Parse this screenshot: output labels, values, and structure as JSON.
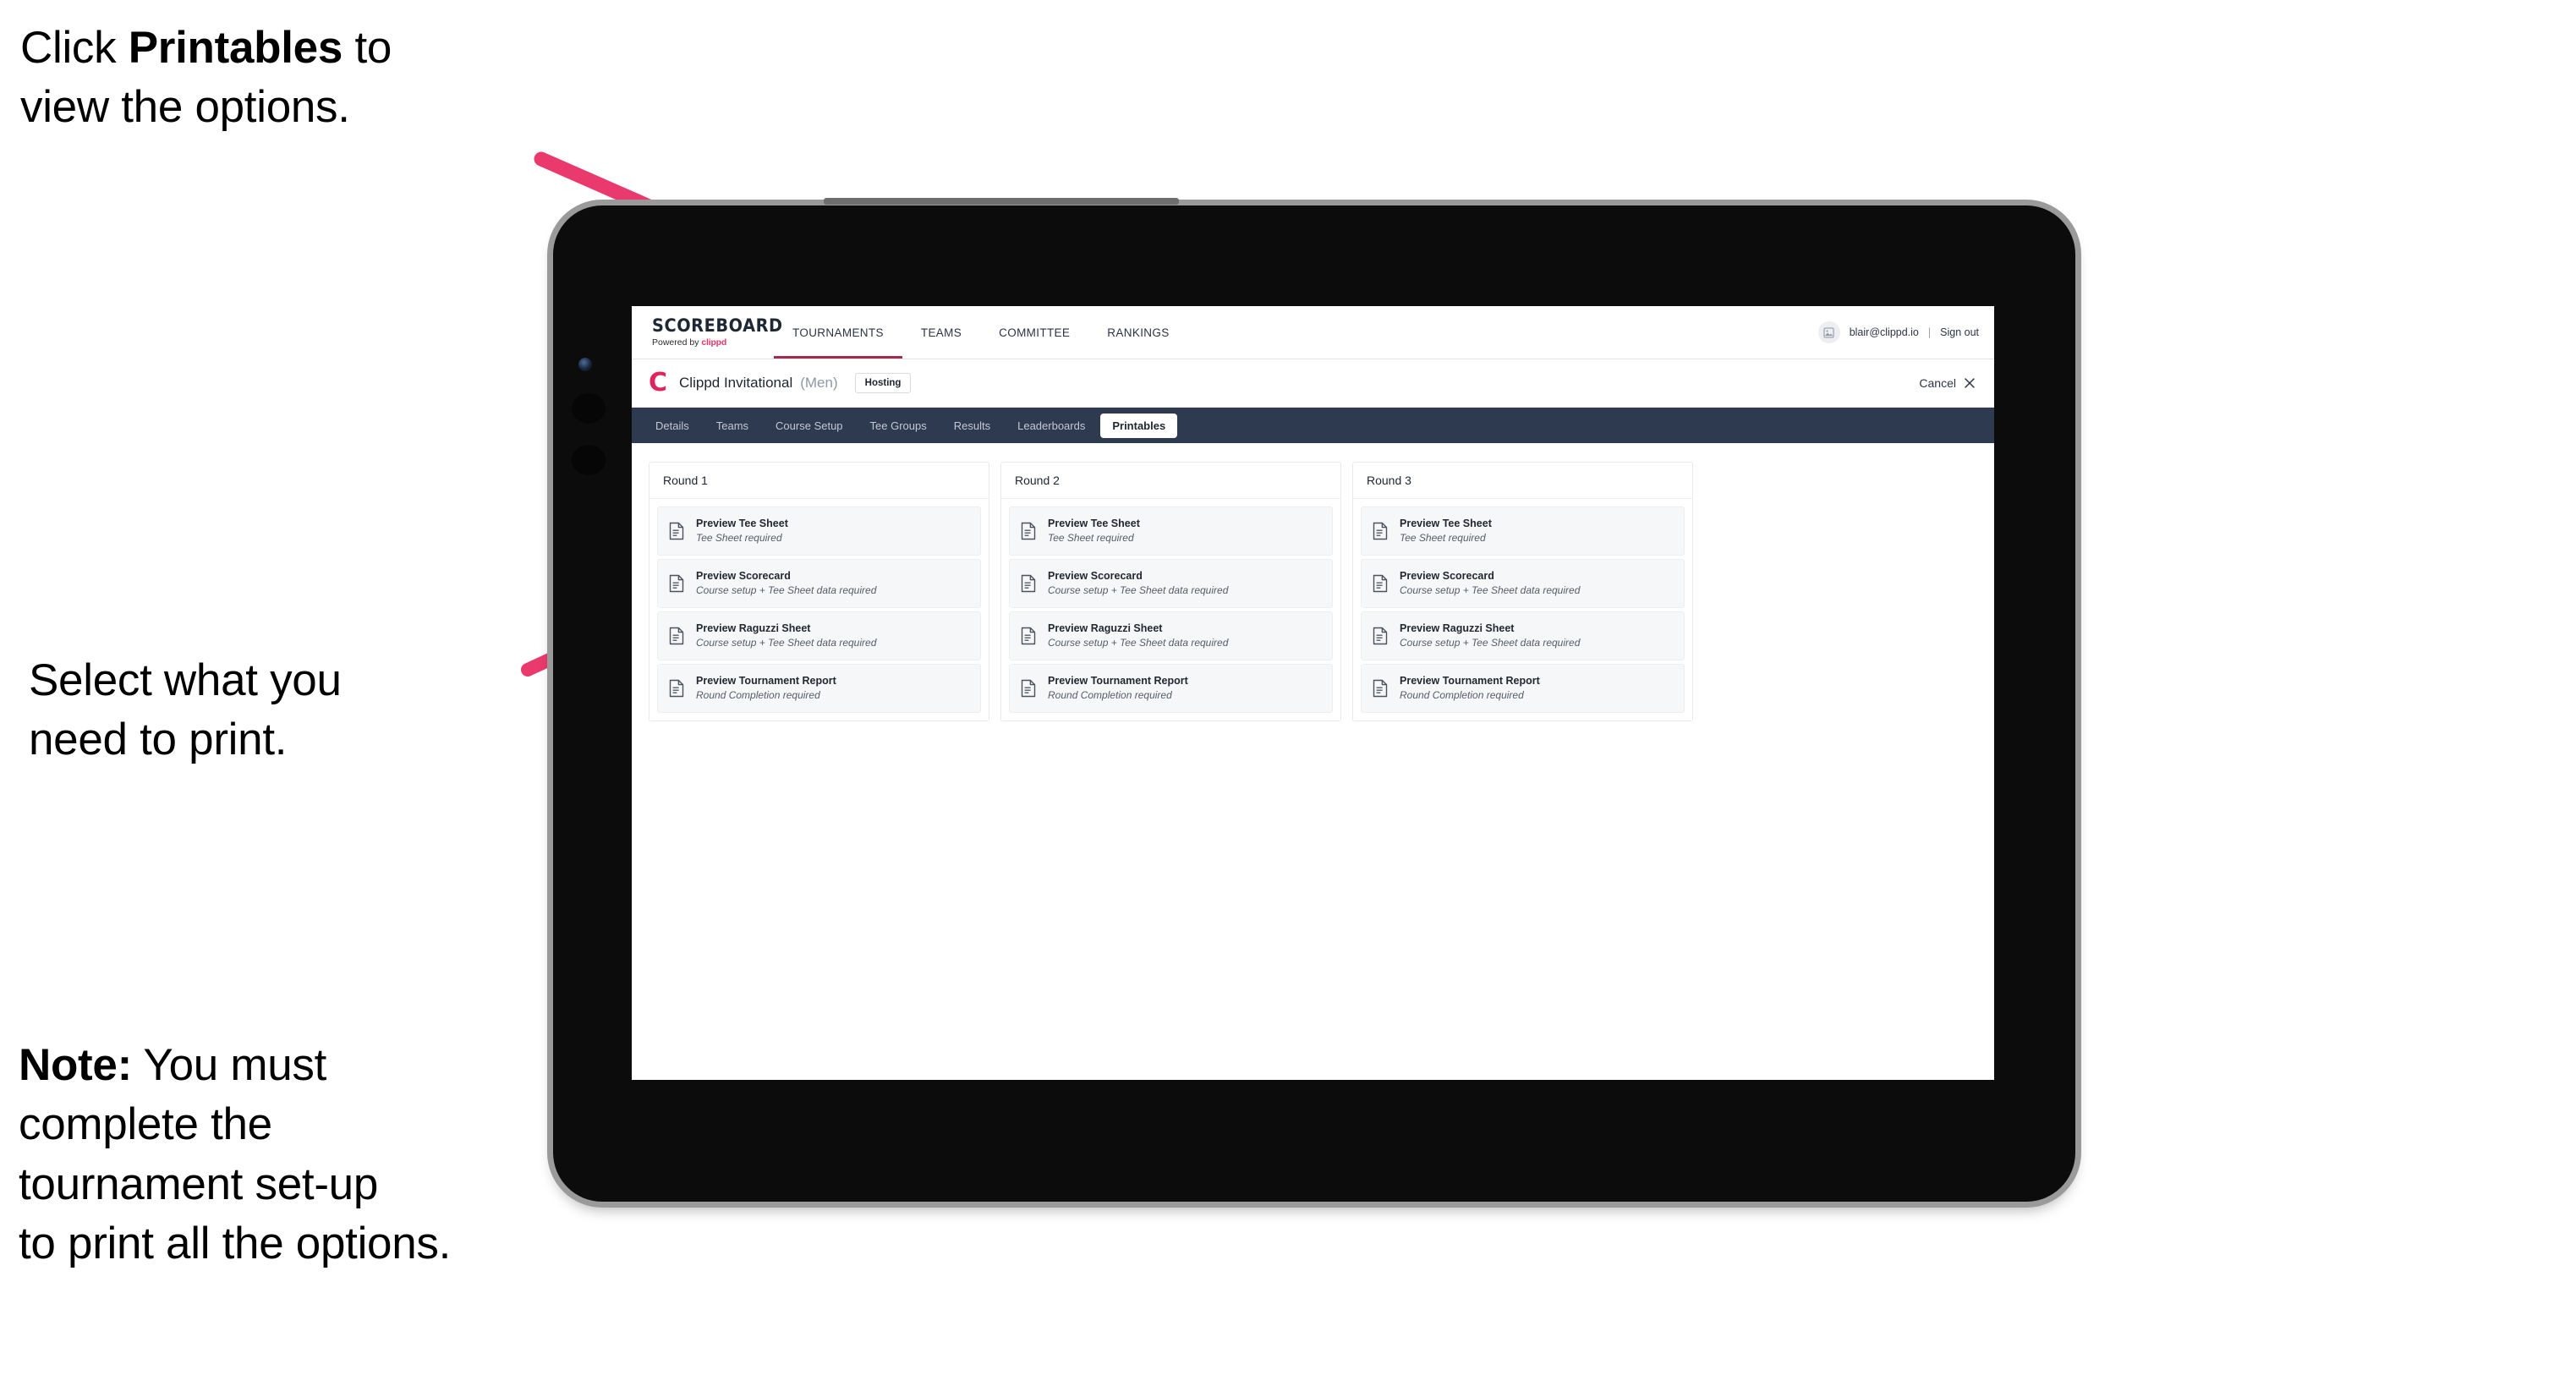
{
  "annotations": [
    {
      "id": "ann-1",
      "prefix": "Click ",
      "bold": "Printables",
      "suffix": " to\nview the options."
    },
    {
      "id": "ann-2",
      "prefix": "",
      "bold": "",
      "suffix": "Select what you\n need to print."
    },
    {
      "id": "ann-3",
      "prefix": "",
      "bold": "Note:",
      "suffix": " You must\ncomplete the\ntournament set-up\nto print all the options."
    }
  ],
  "colors": {
    "arrow_pink": "#ea3a6d",
    "tab_bar_navy": "#2e3a4f",
    "brand_accent": "#e8356b",
    "clippd_red": "#e0245e",
    "nav_underline": "#a32b4d"
  },
  "app": {
    "brand": {
      "name": "SCOREBOARD",
      "powered_by_prefix": "Powered by ",
      "powered_by_mark": "clippd"
    },
    "main_nav": [
      {
        "label": "TOURNAMENTS",
        "active": true
      },
      {
        "label": "TEAMS",
        "active": false
      },
      {
        "label": "COMMITTEE",
        "active": false
      },
      {
        "label": "RANKINGS",
        "active": false
      }
    ],
    "account": {
      "avatar_icon": "image-placeholder-icon",
      "email": "blair@clippd.io",
      "separator": "|",
      "sign_out": "Sign out"
    },
    "tournament_header": {
      "logo_letter": "C",
      "title": "Clippd Invitational",
      "gender": "(Men)",
      "status_badge": "Hosting",
      "cancel_label": "Cancel",
      "cancel_icon": "close-icon"
    },
    "tabs": [
      {
        "label": "Details",
        "active": false
      },
      {
        "label": "Teams",
        "active": false
      },
      {
        "label": "Course Setup",
        "active": false
      },
      {
        "label": "Tee Groups",
        "active": false
      },
      {
        "label": "Results",
        "active": false
      },
      {
        "label": "Leaderboards",
        "active": false
      },
      {
        "label": "Printables",
        "active": true
      }
    ],
    "rounds": [
      {
        "title": "Round 1",
        "items": [
          {
            "icon": "document-icon",
            "title": "Preview Tee Sheet",
            "requirement": "Tee Sheet required"
          },
          {
            "icon": "document-icon",
            "title": "Preview Scorecard",
            "requirement": "Course setup + Tee Sheet data required"
          },
          {
            "icon": "document-icon",
            "title": "Preview Raguzzi Sheet",
            "requirement": "Course setup + Tee Sheet data required"
          },
          {
            "icon": "document-icon",
            "title": "Preview Tournament Report",
            "requirement": "Round Completion required"
          }
        ]
      },
      {
        "title": "Round 2",
        "items": [
          {
            "icon": "document-icon",
            "title": "Preview Tee Sheet",
            "requirement": "Tee Sheet required"
          },
          {
            "icon": "document-icon",
            "title": "Preview Scorecard",
            "requirement": "Course setup + Tee Sheet data required"
          },
          {
            "icon": "document-icon",
            "title": "Preview Raguzzi Sheet",
            "requirement": "Course setup + Tee Sheet data required"
          },
          {
            "icon": "document-icon",
            "title": "Preview Tournament Report",
            "requirement": "Round Completion required"
          }
        ]
      },
      {
        "title": "Round 3",
        "items": [
          {
            "icon": "document-icon",
            "title": "Preview Tee Sheet",
            "requirement": "Tee Sheet required"
          },
          {
            "icon": "document-icon",
            "title": "Preview Scorecard",
            "requirement": "Course setup + Tee Sheet data required"
          },
          {
            "icon": "document-icon",
            "title": "Preview Raguzzi Sheet",
            "requirement": "Course setup + Tee Sheet data required"
          },
          {
            "icon": "document-icon",
            "title": "Preview Tournament Report",
            "requirement": "Round Completion required"
          }
        ]
      }
    ]
  }
}
